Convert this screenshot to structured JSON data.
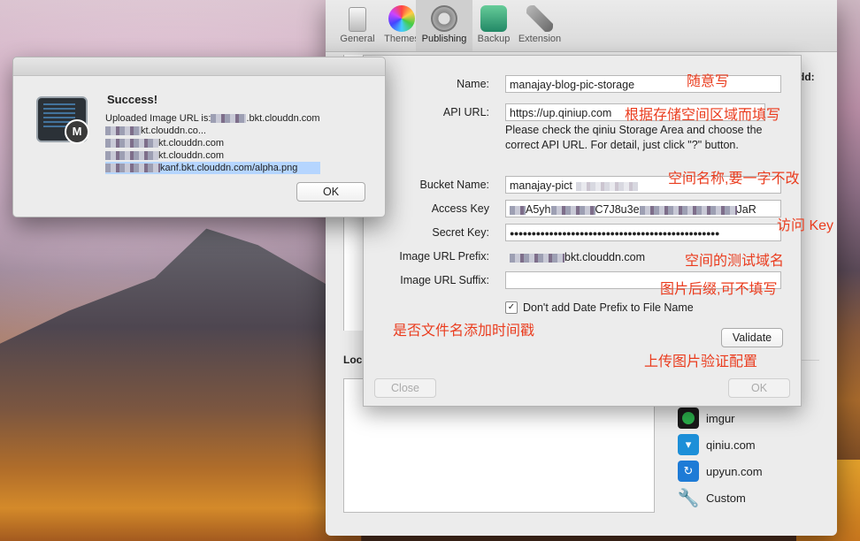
{
  "toolbar": {
    "items": [
      {
        "label": "General",
        "icon": "general-icon"
      },
      {
        "label": "Themes",
        "icon": "themes-icon"
      },
      {
        "label": "Publishing",
        "icon": "publishing-icon"
      },
      {
        "label": "Backup",
        "icon": "backup-icon"
      },
      {
        "label": "Extension",
        "icon": "extension-icon"
      }
    ],
    "active": "Publishing"
  },
  "prefs": {
    "add_label": "dd:",
    "local_label": "Loc"
  },
  "services": [
    {
      "name": "imgur",
      "icon": "imgur-icon"
    },
    {
      "name": "qiniu.com",
      "icon": "qiniu-icon"
    },
    {
      "name": "upyun.com",
      "icon": "upyun-icon"
    },
    {
      "name": "Custom",
      "icon": "wrench-icon"
    }
  ],
  "sheet": {
    "name_label": "Name:",
    "name_value": "manajay-blog-pic-storage",
    "api_label": "API URL:",
    "api_value": "https://up.qiniup.com",
    "help_text": "Please check the qiniu Storage Area and choose the correct API URL. For detail, just click \"?\" button.",
    "bucket_label": "Bucket Name:",
    "bucket_value": "manajay-pict",
    "access_label": "Access Key",
    "access_value_a": "A5yh",
    "access_value_b": "C7J8u3e",
    "access_value_c": "JaR",
    "secret_label": "Secret Key:",
    "secret_value": "●●●●●●●●●●●●●●●●●●●●●●●●●●●●●●●●●●●●●●●●●●●●●●●●",
    "prefix_label": "Image URL Prefix:",
    "prefix_value": "bkt.clouddn.com",
    "suffix_label": "Image URL Suffix:",
    "suffix_value": "",
    "checkbox_label": "Don't add Date Prefix to File Name",
    "checkbox_checked": true,
    "validate_label": "Validate",
    "close_label": "Close",
    "ok_label": "OK"
  },
  "annotations": {
    "name": "随意写",
    "api": "根据存储空间区域而填写",
    "bucket": "空间名称,要一字不改",
    "access": "访问 Key",
    "prefix": "空间的测试域名",
    "suffix": "图片后缀,可不填写",
    "date": "是否文件名添加时间戳",
    "validate": "上传图片验证配置"
  },
  "dialog": {
    "title": "Success!",
    "line1": "Uploaded Image URL is:",
    "line1_tail": ".bkt.clouddn.com",
    "line2_tail": "kt.clouddn.co...",
    "line3_tail": "kt.clouddn.com",
    "line4_tail": "kt.clouddn.com",
    "line5_tail": "kanf.bkt.clouddn.com/alpha.png",
    "ok_label": "OK",
    "badge": "M"
  },
  "colors": {
    "annotation": "#ea3c1e",
    "selection": "#b5d5ff"
  }
}
